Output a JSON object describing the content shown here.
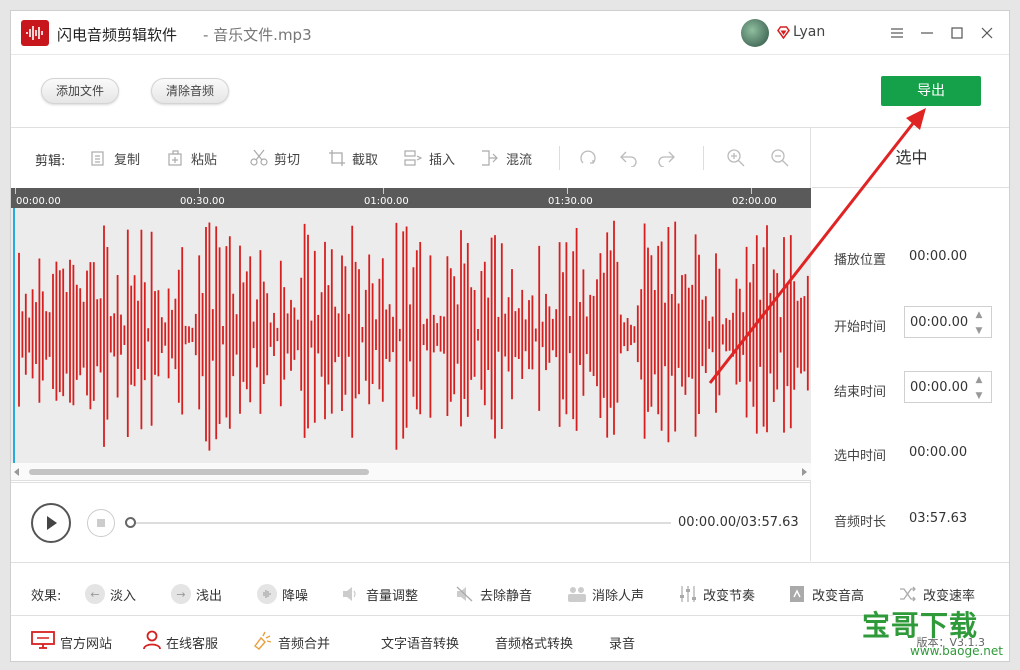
{
  "app": {
    "title": "闪电音频剪辑软件",
    "file_name": "- 音乐文件.mp3",
    "username": "Lyan",
    "window_controls": [
      "menu-icon",
      "minimize-icon",
      "maximize-icon",
      "close-icon"
    ]
  },
  "actions": {
    "add_file": "添加文件",
    "clear_audio": "清除音频",
    "export": "导出"
  },
  "edit_toolbar": {
    "label": "剪辑:",
    "tools": [
      {
        "label": "复制",
        "icon": "copy-icon"
      },
      {
        "label": "粘贴",
        "icon": "paste-icon"
      },
      {
        "label": "剪切",
        "icon": "scissors-icon"
      },
      {
        "label": "截取",
        "icon": "crop-icon"
      },
      {
        "label": "插入",
        "icon": "insert-icon"
      },
      {
        "label": "混流",
        "icon": "mix-icon"
      }
    ],
    "icon_buttons": [
      "loop-icon",
      "undo-icon",
      "redo-icon",
      "zoom-in-icon",
      "zoom-out-icon"
    ]
  },
  "timeline": {
    "ticks": [
      "00:00.00",
      "00:30.00",
      "01:00.00",
      "01:30.00",
      "02:00.00"
    ]
  },
  "player": {
    "time": "00:00.00/03:57.63",
    "progress": 0
  },
  "selection": {
    "title": "选中",
    "play_position_label": "播放位置",
    "play_position": "00:00.00",
    "start_label": "开始时间",
    "start": "00:00.00",
    "end_label": "结束时间",
    "end": "00:00.00",
    "selected_label": "选中时间",
    "selected": "00:00.00",
    "duration_label": "音频时长",
    "duration": "03:57.63"
  },
  "effects": {
    "label": "效果:",
    "items": [
      {
        "label": "淡入",
        "icon": "fade-in-icon"
      },
      {
        "label": "浅出",
        "icon": "fade-out-icon"
      },
      {
        "label": "降噪",
        "icon": "denoise-icon"
      },
      {
        "label": "音量调整",
        "icon": "volume-icon"
      },
      {
        "label": "去除静音",
        "icon": "mute-icon"
      },
      {
        "label": "消除人声",
        "icon": "vocal-remove-icon"
      },
      {
        "label": "改变节奏",
        "icon": "tempo-icon"
      },
      {
        "label": "改变音高",
        "icon": "pitch-icon"
      },
      {
        "label": "改变速率",
        "icon": "rate-icon"
      }
    ]
  },
  "footer": {
    "items": [
      {
        "label": "官方网站",
        "icon": "website-icon"
      },
      {
        "label": "在线客服",
        "icon": "support-icon"
      },
      {
        "label": "音频合并",
        "icon": "merge-icon"
      },
      {
        "label": "文字语音转换"
      },
      {
        "label": "音频格式转换"
      },
      {
        "label": "录音"
      }
    ],
    "version": "版本：V3.1.3"
  },
  "watermark": {
    "text": "宝哥下载",
    "url": "www.baoge.net"
  },
  "colors": {
    "waveform": "#d62020",
    "export_button": "#15a14a",
    "annotation_arrow": "#e02424",
    "playhead": "#2aa8e0"
  }
}
